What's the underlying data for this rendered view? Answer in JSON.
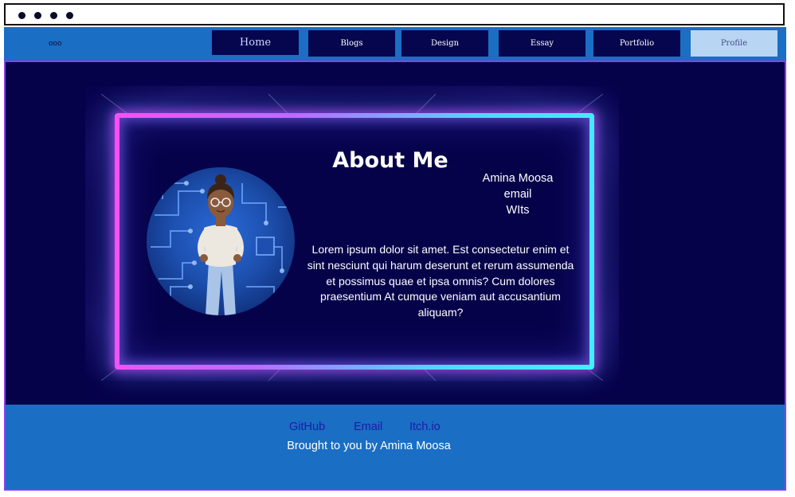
{
  "browser": {
    "window_controls": [
      "dot",
      "dot",
      "dot",
      "dot"
    ]
  },
  "nav": {
    "logo_text": "ooo",
    "tabs": [
      {
        "label": "Home"
      },
      {
        "label": "Blogs"
      },
      {
        "label": "Design"
      },
      {
        "label": "Essay"
      },
      {
        "label": "Portfolio"
      },
      {
        "label": "Profile"
      }
    ]
  },
  "about": {
    "title": "About Me",
    "contact": {
      "name": "Amina Moosa",
      "email": "email",
      "org": "WIts"
    },
    "bio": "Lorem ipsum dolor sit amet. Est consectetur enim et sint nesciunt qui harum deserunt et rerum assumenda et possimus quae et ipsa omnis? Cum dolores praesentium At cumque veniam aut accusantium aliquam?",
    "avatar_icon": "avatar-illustration"
  },
  "footer": {
    "links": [
      {
        "label": "GitHub"
      },
      {
        "label": "Email"
      },
      {
        "label": "Itch.io"
      }
    ],
    "credit": "Brought to you by Amina Moosa"
  },
  "colors": {
    "nav_bg": "#1a6ec4",
    "hero_bg": "#06024a",
    "tab_bg": "#06064e",
    "active_tab_bg": "#b8d6f3",
    "neon_pink": "#ff4df0",
    "neon_cyan": "#3ef2ff",
    "footer_link": "#1c1ca6"
  }
}
